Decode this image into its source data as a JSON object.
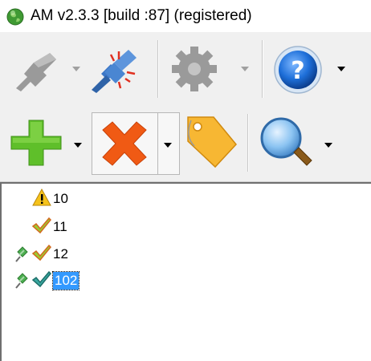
{
  "window": {
    "title": "AM v2.3.3 [build :87] (registered)",
    "app_icon": "green-globe-icon"
  },
  "toolbar_row1": {
    "items": [
      {
        "icon": "disconnect-plug-icon",
        "has_dropdown": true,
        "enabled": false
      },
      {
        "icon": "connect-plug-icon",
        "has_dropdown": false,
        "enabled": true
      },
      {
        "icon": "settings-gear-icon",
        "has_dropdown": true,
        "enabled": false
      },
      {
        "icon": "help-question-icon",
        "has_dropdown": true,
        "enabled": true
      }
    ]
  },
  "toolbar_row2": {
    "items": [
      {
        "icon": "add-plus-icon",
        "has_dropdown": true
      },
      {
        "icon": "delete-x-icon",
        "has_dropdown": true,
        "pressed": true
      },
      {
        "icon": "tag-label-icon",
        "has_dropdown": false
      },
      {
        "icon": "search-magnifier-icon",
        "has_dropdown": true
      }
    ]
  },
  "list": {
    "items": [
      {
        "label": "10",
        "status_icon": "warning-icon",
        "pinned": false,
        "selected": false
      },
      {
        "label": "11",
        "status_icon": "checkmark-icon",
        "pinned": false,
        "selected": false
      },
      {
        "label": "12",
        "status_icon": "checkmark-icon",
        "pinned": true,
        "selected": false
      },
      {
        "label": "102",
        "status_icon": "checkmark-teal-icon",
        "pinned": true,
        "selected": true
      }
    ]
  },
  "colors": {
    "toolbar_bg": "#f0f0f0",
    "selection": "#3399ff",
    "add_green": "#5fbf2a",
    "delete_orange": "#f05a14",
    "tag_yellow": "#f7b733",
    "help_blue": "#1e6fd9"
  }
}
